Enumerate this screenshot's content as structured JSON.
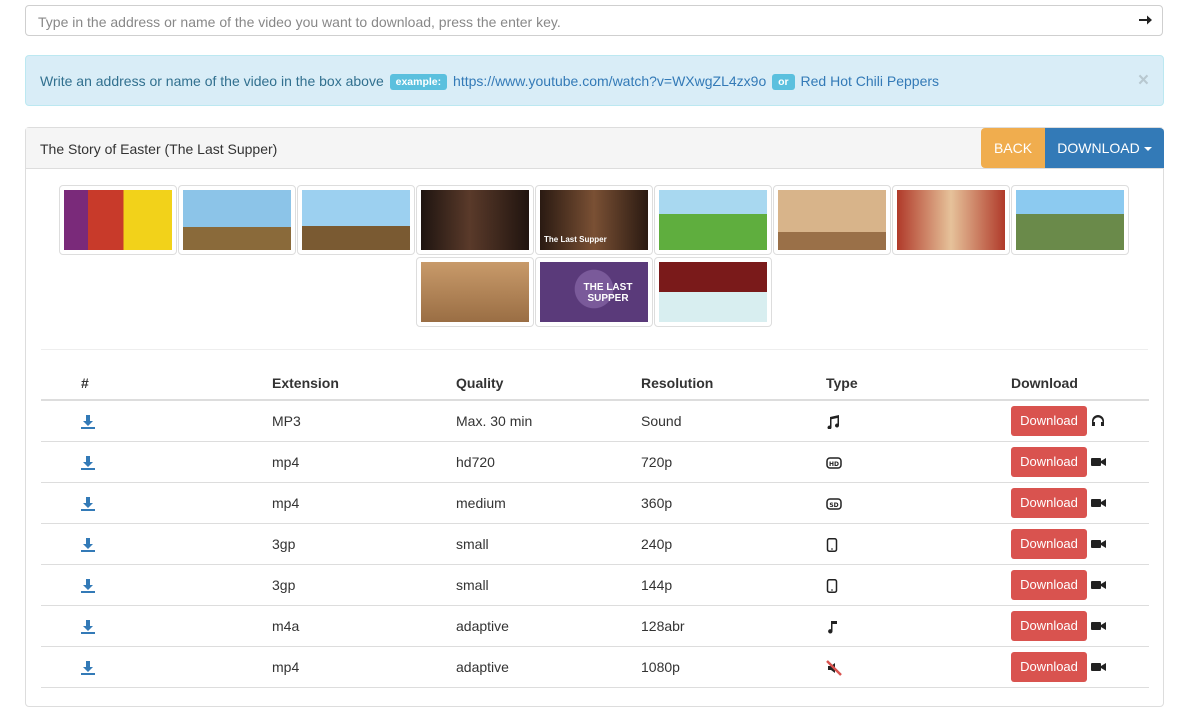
{
  "search": {
    "placeholder": "Type in the address or name of the video you want to download, press the enter key.",
    "value": ""
  },
  "alert": {
    "text": "Write an address or name of the video in the box above",
    "example_label": "example:",
    "example_link": "https://www.youtube.com/watch?v=WXwgZL4zx9o",
    "or_label": "or",
    "or_link": "Red Hot Chili Peppers",
    "close": "×"
  },
  "panel": {
    "title": "The Story of Easter (The Last Supper)",
    "back_label": "BACK",
    "download_label": "DOWNLOAD"
  },
  "thumbnails": [
    {
      "name": "thumbnail-1",
      "caption": ""
    },
    {
      "name": "thumbnail-2",
      "caption": ""
    },
    {
      "name": "thumbnail-3",
      "caption": ""
    },
    {
      "name": "thumbnail-4",
      "caption": ""
    },
    {
      "name": "thumbnail-5",
      "caption": "The Last Supper"
    },
    {
      "name": "thumbnail-6",
      "caption": ""
    },
    {
      "name": "thumbnail-7",
      "caption": ""
    },
    {
      "name": "thumbnail-8",
      "caption": ""
    },
    {
      "name": "thumbnail-9",
      "caption": ""
    },
    {
      "name": "thumbnail-10",
      "caption": ""
    },
    {
      "name": "thumbnail-11",
      "caption": "THE LAST SUPPER"
    },
    {
      "name": "thumbnail-12",
      "caption": ""
    }
  ],
  "table": {
    "headers": [
      "#",
      "Extension",
      "Quality",
      "Resolution",
      "Type",
      "Download"
    ],
    "rows": [
      {
        "ext": "MP3",
        "quality": "Max. 30 min",
        "resolution": "Sound",
        "type_icon": "music-icon",
        "button": "Download",
        "media_icon": "headphones-icon"
      },
      {
        "ext": "mp4",
        "quality": "hd720",
        "resolution": "720p",
        "type_icon": "hd-video-icon",
        "button": "Download",
        "media_icon": "video-camera-icon"
      },
      {
        "ext": "mp4",
        "quality": "medium",
        "resolution": "360p",
        "type_icon": "sd-video-icon",
        "button": "Download",
        "media_icon": "video-camera-icon"
      },
      {
        "ext": "3gp",
        "quality": "small",
        "resolution": "240p",
        "type_icon": "mobile-icon",
        "button": "Download",
        "media_icon": "video-camera-icon"
      },
      {
        "ext": "3gp",
        "quality": "small",
        "resolution": "144p",
        "type_icon": "mobile-icon",
        "button": "Download",
        "media_icon": "video-camera-icon"
      },
      {
        "ext": "m4a",
        "quality": "adaptive",
        "resolution": "128abr",
        "type_icon": "music-note-icon",
        "button": "Download",
        "media_icon": "video-camera-icon"
      },
      {
        "ext": "mp4",
        "quality": "adaptive",
        "resolution": "1080p",
        "type_icon": "no-sound-icon",
        "button": "Download",
        "media_icon": "video-camera-icon"
      }
    ]
  },
  "colors": {
    "back": "#f0ad4e",
    "download": "#337ab7",
    "download_row": "#d9534f",
    "alert_bg": "#d9edf7",
    "label": "#5bc0de"
  }
}
